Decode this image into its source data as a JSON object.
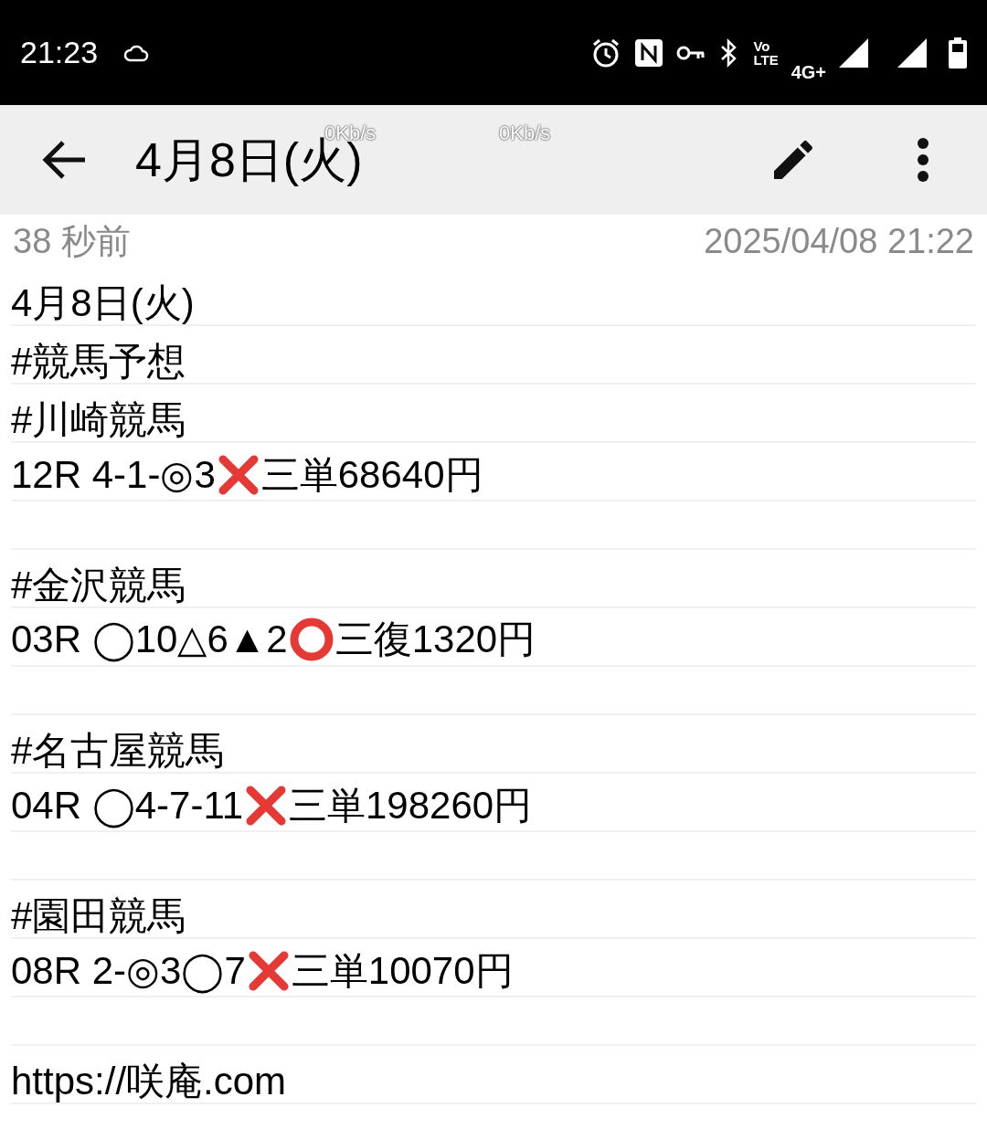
{
  "status_bar": {
    "time": "21:23",
    "volte": [
      "Vo",
      "LTE"
    ],
    "network": "4G+"
  },
  "app_bar": {
    "title": "4月8日(火)",
    "speeds": [
      "0Kb/s",
      "0Kb/s"
    ]
  },
  "meta": {
    "relative": "38 秒前",
    "timestamp": "2025/04/08 21:22"
  },
  "sections": [
    {
      "lines": [
        [
          {
            "kind": "text",
            "text": "4月8日(火)"
          }
        ],
        [
          {
            "kind": "text",
            "text": "#競馬予想"
          }
        ],
        [
          {
            "kind": "text",
            "text": "#川崎競馬"
          }
        ],
        [
          {
            "kind": "text",
            "text": "12R 4-1-◎3"
          },
          {
            "kind": "cross"
          },
          {
            "kind": "text",
            "text": "三単68640円"
          }
        ]
      ]
    },
    {
      "lines": [
        [
          {
            "kind": "text",
            "text": "#金沢競馬"
          }
        ],
        [
          {
            "kind": "text",
            "text": "03R ◯10△6▲2"
          },
          {
            "kind": "ring"
          },
          {
            "kind": "text",
            "text": "三復1320円"
          }
        ]
      ]
    },
    {
      "lines": [
        [
          {
            "kind": "text",
            "text": "#名古屋競馬"
          }
        ],
        [
          {
            "kind": "text",
            "text": "04R ◯4-7-11"
          },
          {
            "kind": "cross"
          },
          {
            "kind": "text",
            "text": "三単198260円"
          }
        ]
      ]
    },
    {
      "lines": [
        [
          {
            "kind": "text",
            "text": "#園田競馬"
          }
        ],
        [
          {
            "kind": "text",
            "text": "08R 2-◎3◯7"
          },
          {
            "kind": "cross"
          },
          {
            "kind": "text",
            "text": "三単10070円"
          }
        ]
      ]
    },
    {
      "lines": [
        [
          {
            "kind": "text",
            "text": "https://咲庵.com"
          }
        ]
      ]
    }
  ]
}
